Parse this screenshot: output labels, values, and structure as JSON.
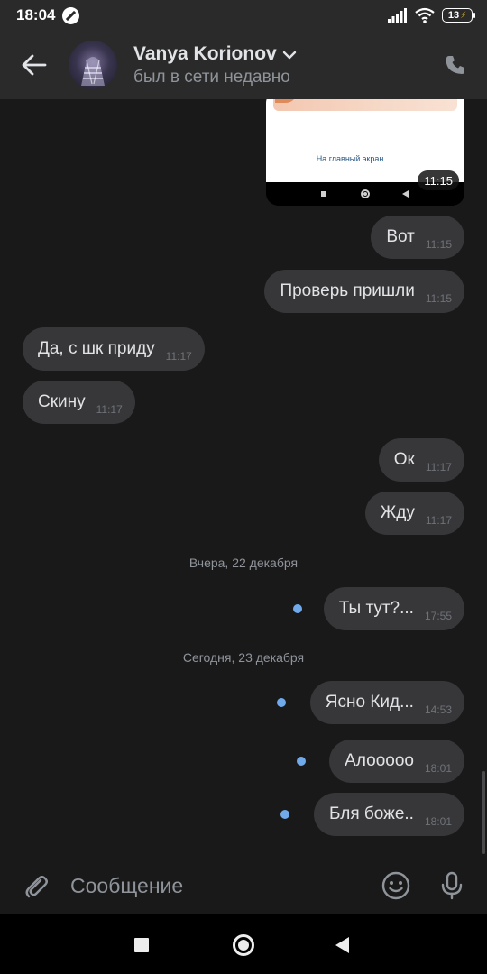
{
  "status_bar": {
    "time": "18:04",
    "battery": "13"
  },
  "header": {
    "name": "Vanya Korionov",
    "status": "был в сети недавно"
  },
  "image_message": {
    "link_text": "На главный экран",
    "time": "11:15"
  },
  "messages": [
    {
      "text": "Вот",
      "time": "11:15"
    },
    {
      "text": "Проверь пришли",
      "time": "11:15"
    },
    {
      "text": "Да, с шк приду",
      "time": "11:17"
    },
    {
      "text": "Скину",
      "time": "11:17"
    },
    {
      "text": "Ок",
      "time": "11:17"
    },
    {
      "text": "Жду",
      "time": "11:17"
    },
    {
      "text": "Ты тут?...",
      "time": "17:55"
    },
    {
      "text": "Ясно Кид...",
      "time": "14:53"
    },
    {
      "text": "Алооооо",
      "time": "18:01"
    },
    {
      "text": "Бля боже..",
      "time": "18:01"
    }
  ],
  "dates": {
    "yesterday": "Вчера, 22 декабря",
    "today": "Сегодня, 23 декабря"
  },
  "composer": {
    "placeholder": "Сообщение"
  },
  "colors": {
    "background": "#19191a",
    "bubble": "#373739",
    "header": "#2a2a2b",
    "unread_dot": "#71aaeb"
  },
  "icons": {
    "back": "arrow-left-icon",
    "call": "phone-icon",
    "attach": "paperclip-icon",
    "emoji": "smile-icon",
    "mic": "microphone-icon"
  }
}
